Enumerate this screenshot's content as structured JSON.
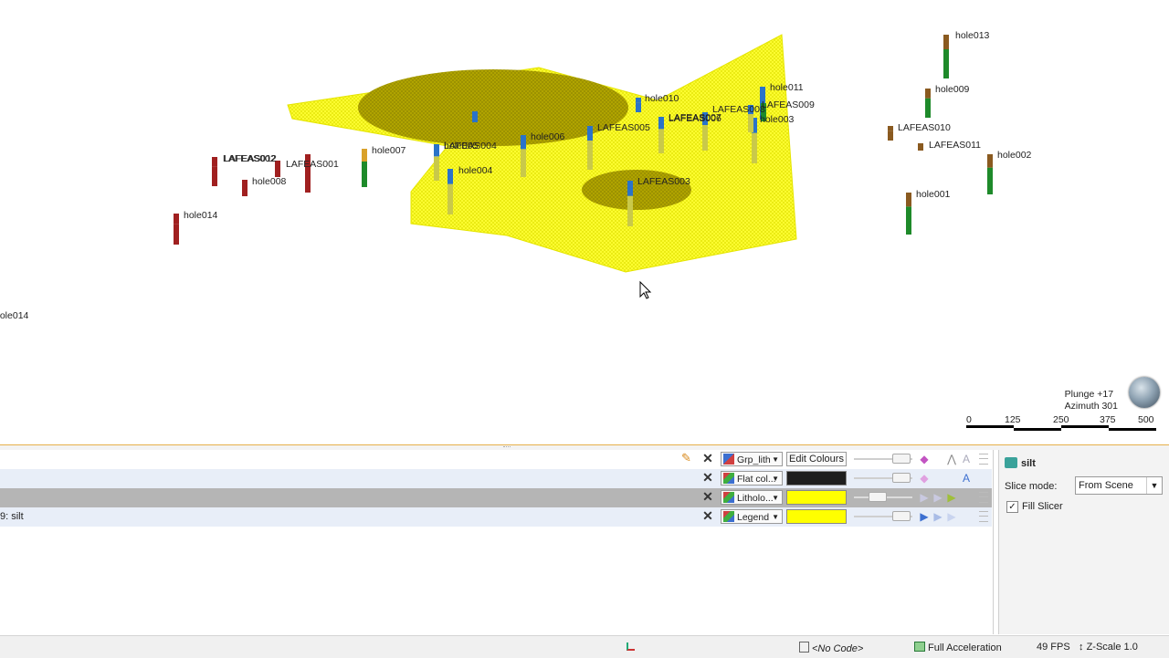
{
  "viewport": {
    "hole_labels": [
      "hole013",
      "hole009",
      "LAFEAS010",
      "LAFEAS011",
      "hole002",
      "hole001",
      "hole011",
      "LAFEAS009",
      "hole003",
      "LAFEAS008",
      "LAFEAS007",
      "hole010",
      "LAFEAS006",
      "LAFEAS005",
      "hole006",
      "LAFEAS004",
      "hole005",
      "hole004",
      "LAFEAS003",
      "hole007",
      "LAFEAS001",
      "LAFEAS012",
      "LAFEAS002",
      "hole008",
      "hole014"
    ],
    "orientation": {
      "plunge": "Plunge +17",
      "azimuth": "Azimuth 301"
    },
    "scale": {
      "ticks": [
        "0",
        "125",
        "250",
        "375",
        "500"
      ]
    },
    "colors": {
      "surface": "#ffff00",
      "frame": "#e6b04a"
    }
  },
  "layers": {
    "rows": [
      {
        "name": "",
        "style": "Grp_lith",
        "style_icon": "edit-style-icon",
        "color_button": "Edit Colours"
      },
      {
        "name": "",
        "style": "Flat col...",
        "style_icon": "style-icon",
        "swatch": "#1e1e1e"
      },
      {
        "name": "",
        "style": "Litholo...",
        "style_icon": "style-icon",
        "swatch": "#ffff00"
      },
      {
        "name": "9: silt",
        "style": "Legend",
        "style_icon": "style-icon",
        "swatch": "#ffff00"
      }
    ]
  },
  "properties": {
    "title": "silt",
    "slice_mode_label": "Slice mode:",
    "slice_mode_value": "From Scene",
    "fill_slicer_label": "Fill Slicer",
    "fill_slicer_checked": "✓"
  },
  "status": {
    "code": "<No Code>",
    "acceleration": "Full Acceleration",
    "fps": "49 FPS",
    "zscale": "Z-Scale 1.0"
  }
}
